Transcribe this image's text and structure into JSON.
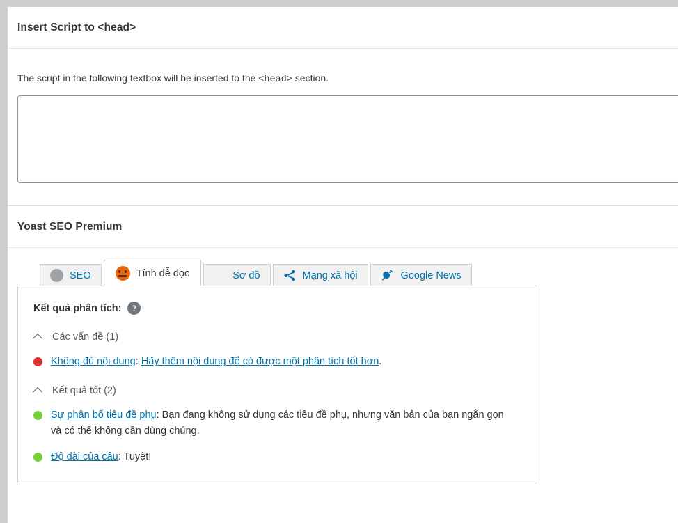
{
  "script_panel": {
    "title": "Insert Script to <head>",
    "description_before": "The script in the following textbox will be inserted to the ",
    "description_code": "<head>",
    "description_after": " section.",
    "textarea_value": "",
    "textarea_placeholder": ""
  },
  "yoast_panel": {
    "title": "Yoast SEO Premium",
    "tabs": [
      {
        "label": "SEO",
        "icon": "grey-circle-icon",
        "active": false
      },
      {
        "label": "Tính dễ đọc",
        "icon": "orange-neutral-smiley-icon",
        "active": true
      },
      {
        "label": "Sơ đồ",
        "icon": "grid-icon",
        "active": false
      },
      {
        "label": "Mạng xã hội",
        "icon": "share-icon",
        "active": false
      },
      {
        "label": "Google News",
        "icon": "plug-icon",
        "active": false
      }
    ],
    "analysis": {
      "heading": "Kết quả phân tích:",
      "help_icon_glyph": "?",
      "groups": [
        {
          "title": "Các vấn đề (1)",
          "items": [
            {
              "bullet": "red",
              "link_text": "Không đủ nội dung",
              "separator": ": ",
              "body_link": "Hãy thêm nội dung để có được một phân tích tốt hơn",
              "body_tail": "."
            }
          ]
        },
        {
          "title": "Kết quả tốt (2)",
          "items": [
            {
              "bullet": "green",
              "link_text": "Sự phân bố tiêu đề phụ",
              "separator": ": ",
              "body_link": "",
              "body_tail": "Bạn đang không sử dụng các tiêu đề phụ, nhưng văn bản của bạn ngắn gọn và có thể không cần dùng chúng."
            },
            {
              "bullet": "green",
              "link_text": "Độ dài của câu",
              "separator": ": ",
              "body_link": "",
              "body_tail": "Tuyệt!"
            }
          ]
        }
      ]
    }
  },
  "colors": {
    "link": "#0073aa",
    "smiley_orange": "#e8660c",
    "bullet_red": "#dc3232",
    "bullet_green": "#7ad03a",
    "border": "#ccd0d4",
    "gutter": "#cfcfcf"
  }
}
